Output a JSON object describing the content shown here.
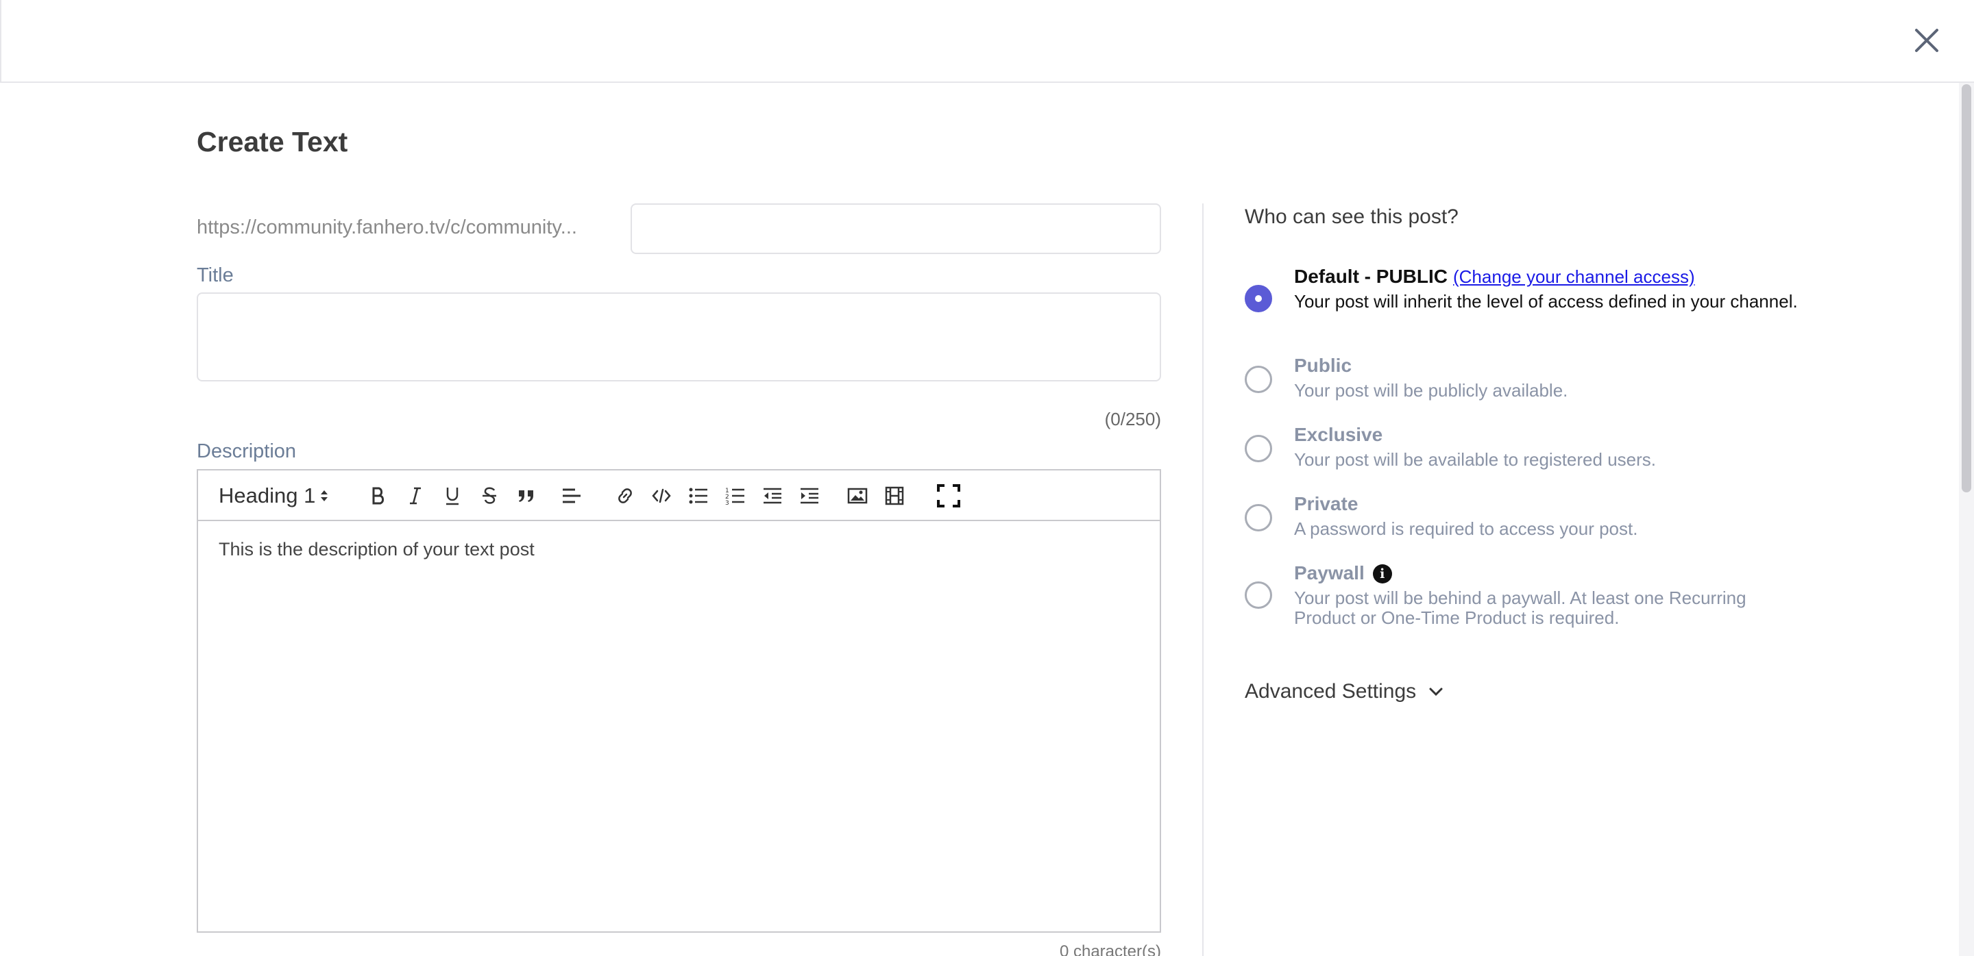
{
  "header": {
    "close_icon": "close-icon"
  },
  "page": {
    "title": "Create Text"
  },
  "url": {
    "prefix": "https://community.fanhero.tv/c/community...",
    "slug_value": ""
  },
  "title_field": {
    "label": "Title",
    "value": "",
    "count": "(0/250)"
  },
  "description": {
    "label": "Description",
    "heading_select": "Heading 1",
    "toolbar_icons": [
      "bold-icon",
      "italic-icon",
      "underline-icon",
      "strikethrough-icon",
      "quote-icon",
      "align-left-icon",
      "link-icon",
      "code-icon",
      "bullet-list-icon",
      "numbered-list-icon",
      "outdent-icon",
      "indent-icon",
      "image-icon",
      "video-icon",
      "fullscreen-icon"
    ],
    "placeholder_text": "This is the description of your text post",
    "char_count": "0 character(s)"
  },
  "visibility": {
    "heading": "Who can see this post?",
    "options": [
      {
        "name": "Default - PUBLIC",
        "link": "(Change your channel access)",
        "desc": "Your post will inherit the level of access defined in your channel.",
        "selected": true
      },
      {
        "name": "Public",
        "desc": "Your post will be publicly available.",
        "selected": false
      },
      {
        "name": "Exclusive",
        "desc": "Your post will be available to registered users.",
        "selected": false
      },
      {
        "name": "Private",
        "desc": "A password is required to access your post.",
        "selected": false
      },
      {
        "name": "Paywall",
        "desc": "Your post will be behind a paywall. At least one Recurring Product or One-Time Product is required.",
        "selected": false,
        "info_icon": "info-icon"
      }
    ],
    "accent_color": "#5b5bd6"
  },
  "advanced": {
    "label": "Advanced Settings"
  }
}
